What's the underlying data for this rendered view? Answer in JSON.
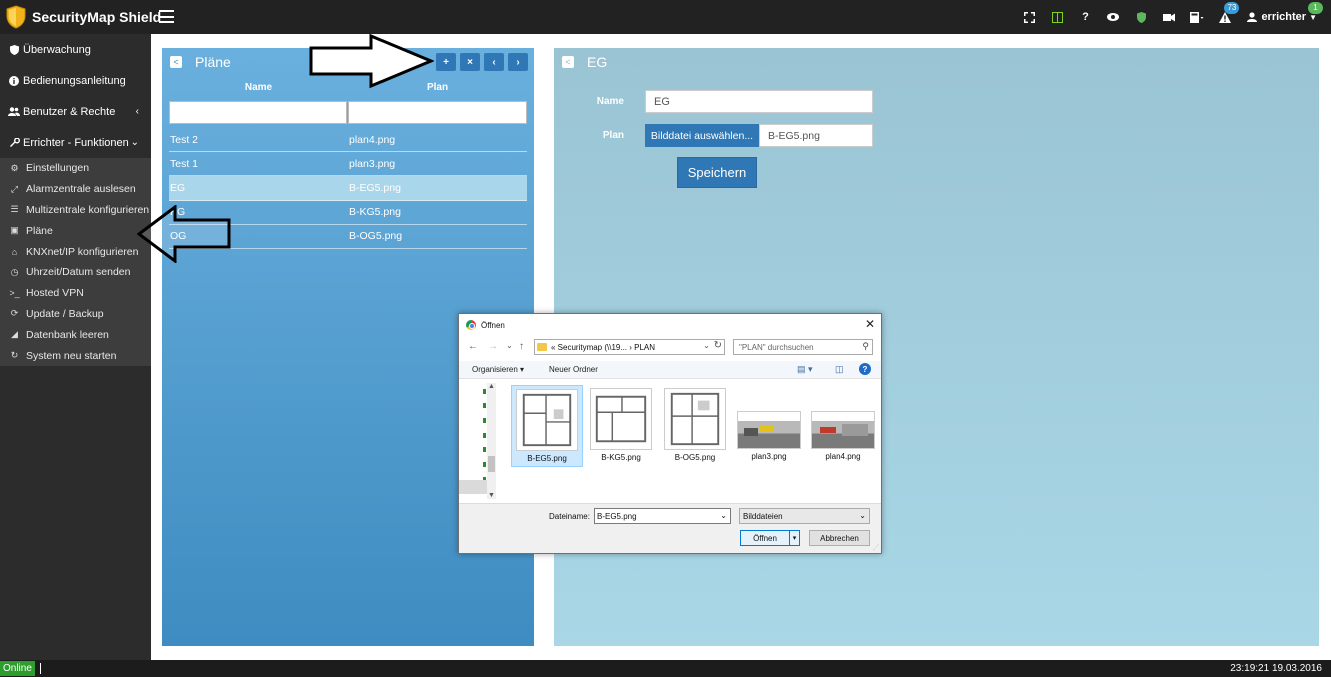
{
  "header": {
    "brand": "SecurityMap Shield",
    "icons": [
      "expand-icon",
      "layout-icon",
      "help-icon",
      "eye-icon",
      "shield-icon",
      "camera-icon",
      "calculator-icon",
      "warning-icon"
    ],
    "help_glyph": "?",
    "alerts_count": "73",
    "user": {
      "name": "errichter",
      "badge": "1"
    }
  },
  "sidebar": {
    "items": [
      {
        "label": "Überwachung",
        "icon": "shield-icon"
      },
      {
        "label": "Bedienungsanleitung",
        "icon": "info-icon"
      },
      {
        "label": "Benutzer & Rechte",
        "icon": "users-icon",
        "chevron": "‹"
      },
      {
        "label": "Errichter - Funktionen",
        "icon": "wrench-icon",
        "chevron": "⌄"
      }
    ],
    "subitems": [
      {
        "label": "Einstellungen",
        "icon": "cogs-icon"
      },
      {
        "label": "Alarmzentrale auslesen",
        "icon": "plug-icon"
      },
      {
        "label": "Multizentrale konfigurieren",
        "icon": "server-icon"
      },
      {
        "label": "Pläne",
        "icon": "share-icon"
      },
      {
        "label": "KNXnet/IP konfigurieren",
        "icon": "home-icon"
      },
      {
        "label": "Uhrzeit/Datum senden",
        "icon": "clock-icon"
      },
      {
        "label": "Hosted VPN",
        "icon": "terminal-icon"
      },
      {
        "label": "Update / Backup",
        "icon": "refresh-icon"
      },
      {
        "label": "Datenbank leeren",
        "icon": "eraser-icon"
      },
      {
        "label": "System neu starten",
        "icon": "restart-icon"
      }
    ]
  },
  "plans_panel": {
    "title": "Pläne",
    "buttons": {
      "add": "+",
      "delete": "×",
      "prev": "‹",
      "next": "›"
    },
    "columns": {
      "name": "Name",
      "plan": "Plan"
    },
    "rows": [
      {
        "name": "Test 2",
        "plan": "plan4.png"
      },
      {
        "name": "Test 1",
        "plan": "plan3.png"
      },
      {
        "name": "EG",
        "plan": "B-EG5.png",
        "selected": true
      },
      {
        "name": "KG",
        "plan": "B-KG5.png"
      },
      {
        "name": "OG",
        "plan": "B-OG5.png"
      }
    ]
  },
  "detail_panel": {
    "title": "EG",
    "name_label": "Name",
    "name_value": "EG",
    "plan_label": "Plan",
    "choose_file_button": "Bilddatei auswählen...",
    "file_value": "B-EG5.png",
    "save_button": "Speichern"
  },
  "file_dialog": {
    "title": "Öffnen",
    "close": "✕",
    "nav": {
      "back": "←",
      "forward": "→",
      "recent": "⌄",
      "up": "↑"
    },
    "path": "« Securitymap (\\\\19... › PLAN",
    "search_placeholder": "\"PLAN\" durchsuchen",
    "toolbar": {
      "organize": "Organisieren ▾",
      "new_folder": "Neuer Ordner",
      "help": "?"
    },
    "files": [
      {
        "name": "B-EG5.png",
        "kind": "floorplan",
        "selected": true
      },
      {
        "name": "B-KG5.png",
        "kind": "floorplan"
      },
      {
        "name": "B-OG5.png",
        "kind": "floorplan"
      },
      {
        "name": "plan3.png",
        "kind": "3d"
      },
      {
        "name": "plan4.png",
        "kind": "3d"
      }
    ],
    "filename_label": "Dateiname:",
    "filename_value": "B-EG5.png",
    "filetype_value": "Bilddateien",
    "open_button": "Öffnen",
    "cancel_button": "Abbrechen"
  },
  "statusbar": {
    "status": "Online",
    "clock": "23:19:21 19.03.2016"
  },
  "colors": {
    "topbar": "#222222",
    "sidebar": "#2c2c2c",
    "panel_blue": "#4d9fd3",
    "panel_light": "#a3cfe0",
    "button_blue": "#2f77b5",
    "online_green": "#2d9e2d"
  }
}
